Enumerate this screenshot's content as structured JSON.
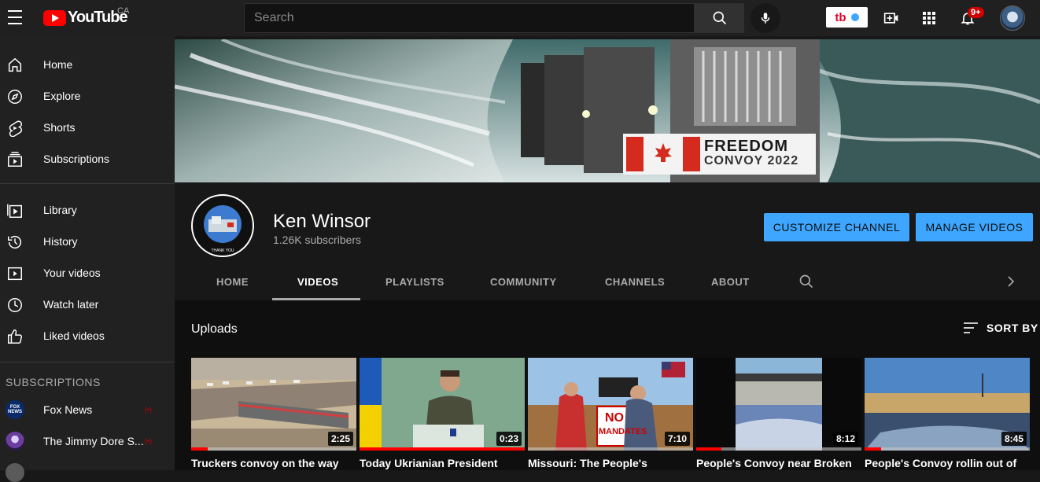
{
  "topbar": {
    "logo_text": "YouTube",
    "country_code": "CA",
    "search_placeholder": "Search",
    "extension_label": "tb",
    "notification_count": "9+"
  },
  "sidebar": {
    "main": [
      {
        "label": "Home",
        "icon": "home-icon"
      },
      {
        "label": "Explore",
        "icon": "compass-icon"
      },
      {
        "label": "Shorts",
        "icon": "shorts-icon"
      },
      {
        "label": "Subscriptions",
        "icon": "subscriptions-icon"
      }
    ],
    "library": [
      {
        "label": "Library",
        "icon": "library-icon"
      },
      {
        "label": "History",
        "icon": "history-icon"
      },
      {
        "label": "Your videos",
        "icon": "your-videos-icon"
      },
      {
        "label": "Watch later",
        "icon": "clock-icon"
      },
      {
        "label": "Liked videos",
        "icon": "thumbs-up-icon"
      }
    ],
    "subscriptions_heading": "SUBSCRIPTIONS",
    "subscriptions": [
      {
        "label": "Fox News",
        "live": "(•)"
      },
      {
        "label": "The Jimmy Dore S...",
        "live": "(•)"
      }
    ]
  },
  "banner": {
    "line1": "FREEDOM",
    "line2": "CONVOY 2022"
  },
  "channel": {
    "name": "Ken Winsor",
    "subscribers": "1.26K subscribers",
    "customize_label": "CUSTOMIZE CHANNEL",
    "manage_label": "MANAGE VIDEOS",
    "avatar_text": "THANK YOU"
  },
  "tabs": [
    "HOME",
    "VIDEOS",
    "PLAYLISTS",
    "COMMUNITY",
    "CHANNELS",
    "ABOUT"
  ],
  "active_tab": "VIDEOS",
  "uploads": {
    "heading": "Uploads",
    "sort_label": "SORT BY"
  },
  "videos": [
    {
      "title": "Truckers convoy on the way",
      "duration": "2:25",
      "progress": 0.1
    },
    {
      "title": "Today Ukrianian President",
      "duration": "0:23",
      "progress": 1.0
    },
    {
      "title": "Missouri: The People's",
      "duration": "7:10",
      "progress": 0
    },
    {
      "title": "People's Convoy near Broken",
      "duration": "8:12",
      "progress": 0.15
    },
    {
      "title": "People's Convoy rollin out of",
      "duration": "8:45",
      "progress": 0.1
    }
  ],
  "thumb_texts": {
    "fox_news": "FOX NEWS",
    "no_mandates_1": "NO",
    "no_mandates_2": "MANDATES"
  },
  "colors": {
    "accent_blue": "#3ea6ff",
    "brand_red": "#ff0000",
    "background": "#181818"
  }
}
